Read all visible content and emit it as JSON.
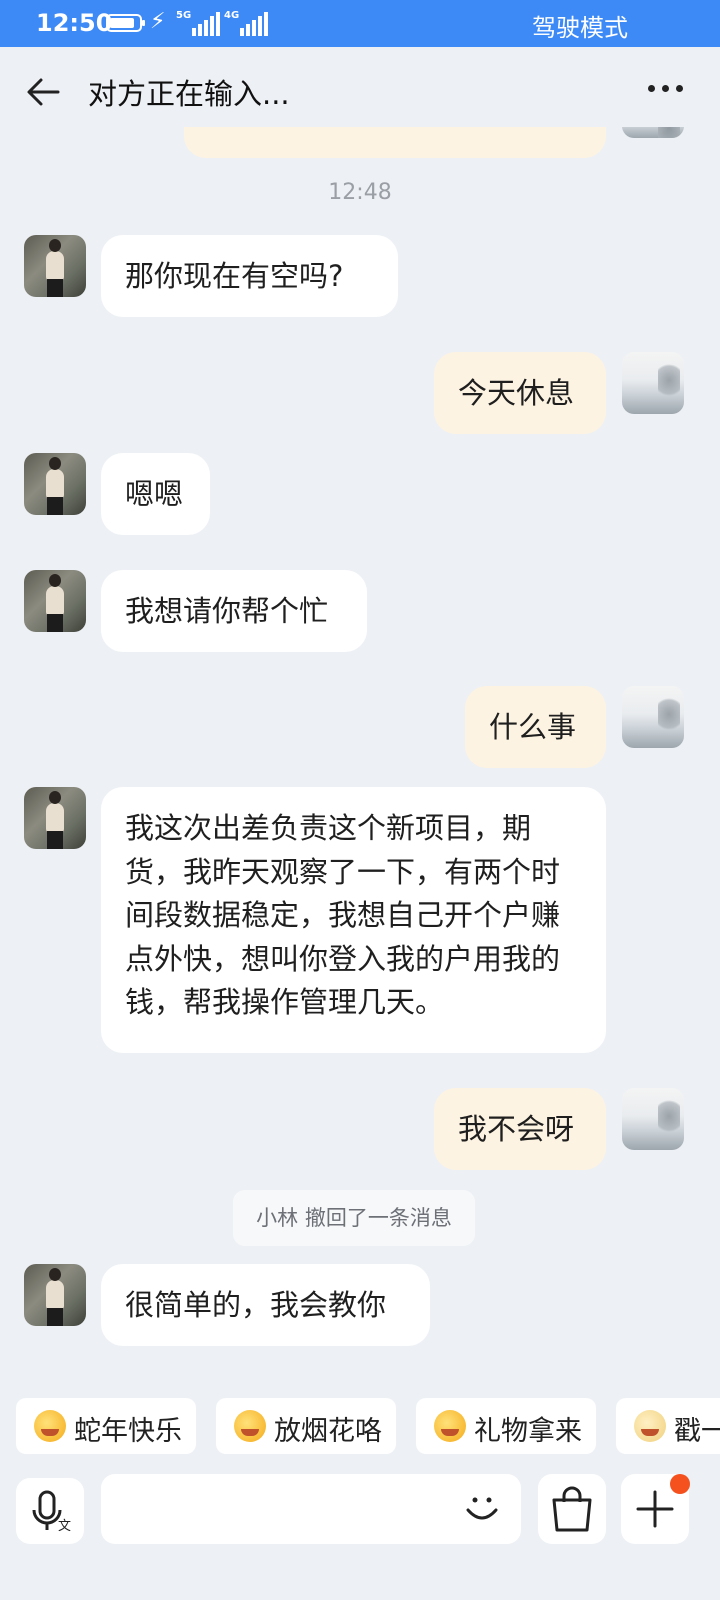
{
  "status_bar": {
    "time": "12:50",
    "network_1": "5G",
    "network_2": "4G",
    "drive_mode": "驾驶模式"
  },
  "header": {
    "title": "对方正在输入..."
  },
  "chat": {
    "time_separator": "12:48",
    "messages": [
      {
        "from": "other",
        "text": "那你现在有空吗?"
      },
      {
        "from": "self",
        "text": "今天休息"
      },
      {
        "from": "other",
        "text": "嗯嗯"
      },
      {
        "from": "other",
        "text": "我想请你帮个忙"
      },
      {
        "from": "self",
        "text": "什么事"
      },
      {
        "from": "other",
        "text": "我这次出差负责这个新项目，期货，我昨天观察了一下，有两个时间段数据稳定，我想自己开个户赚点外快，想叫你登入我的户用我的钱，帮我操作管理几天。"
      },
      {
        "from": "self",
        "text": "我不会呀"
      },
      {
        "from": "other",
        "text": "很简单的，我会教你"
      }
    ],
    "recall_notice": "小林 撤回了一条消息"
  },
  "quick_stickers": [
    "蛇年快乐",
    "放烟花咯",
    "礼物拿来",
    "戳一"
  ],
  "input_bar": {
    "placeholder": "",
    "plus_badge_color": "#f4511e"
  },
  "colors": {
    "status_bar": "#3d8af7",
    "background": "#edf0f4",
    "incoming_bubble": "#ffffff",
    "outgoing_bubble": "#fdf3e2"
  }
}
